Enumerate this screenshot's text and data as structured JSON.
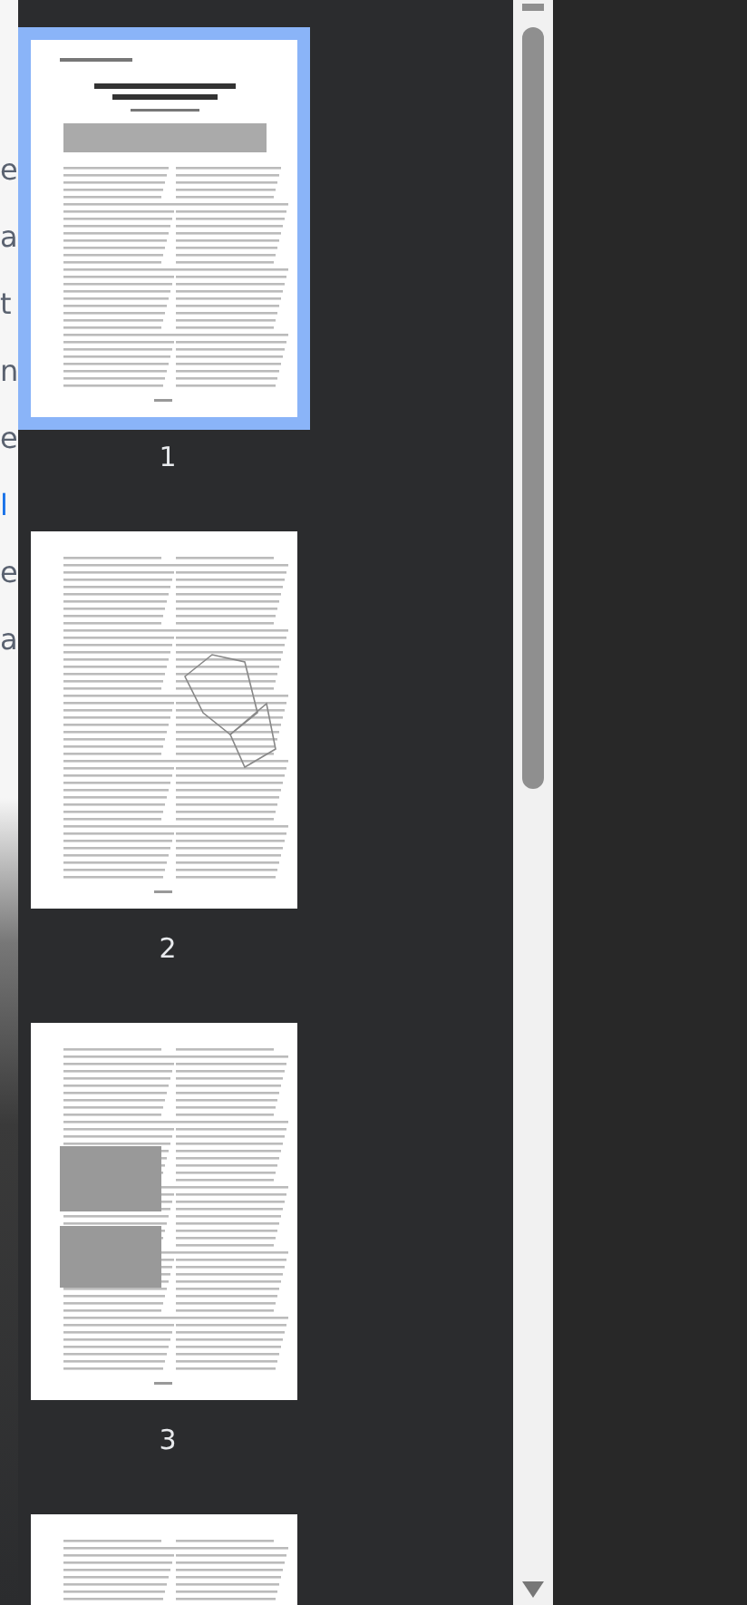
{
  "background_text": [
    {
      "text": "e",
      "link": false
    },
    {
      "text": "a",
      "link": false
    },
    {
      "text": "t",
      "link": false
    },
    {
      "text": "n",
      "link": false
    },
    {
      "text": "e",
      "link": false
    },
    {
      "text": "l",
      "link": true
    },
    {
      "text": "e",
      "link": false
    },
    {
      "text": "a",
      "link": false
    }
  ],
  "pages": [
    {
      "label": "1",
      "selected": true
    },
    {
      "label": "2",
      "selected": false
    },
    {
      "label": "3",
      "selected": false
    },
    {
      "selected": false
    }
  ]
}
